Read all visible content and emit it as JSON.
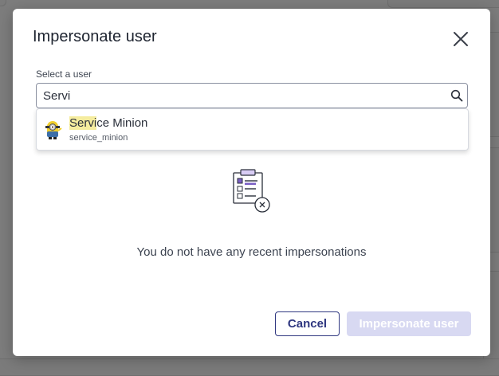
{
  "modal": {
    "title": "Impersonate user",
    "close_icon": "close-icon"
  },
  "search": {
    "label": "Select a user",
    "value": "Servi",
    "icon": "search-icon"
  },
  "results": [
    {
      "name_match": "Servi",
      "name_rest": "ce Minion",
      "username": "service_minion",
      "avatar": "minion-avatar-icon"
    }
  ],
  "empty_state": {
    "icon": "clipboard-checklist-icon",
    "message": "You do not have any recent impersonations"
  },
  "actions": {
    "cancel_label": "Cancel",
    "impersonate_label": "Impersonate user"
  },
  "colors": {
    "overlay": "#7d7d7d",
    "primary": "#2f3780",
    "primary_disabled": "#d8d9f2",
    "highlight": "#f5ec9e",
    "icon_accent": "#7a5fc4"
  }
}
